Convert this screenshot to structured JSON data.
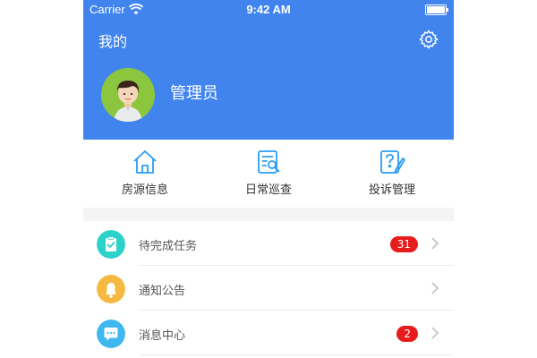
{
  "status_bar": {
    "carrier": "Carrier",
    "time": "9:42 AM"
  },
  "header": {
    "title": "我的",
    "username": "管理员",
    "background": "#4184ee"
  },
  "quick_actions": [
    {
      "label": "房源信息",
      "icon": "house-icon"
    },
    {
      "label": "日常巡查",
      "icon": "inspection-doc-icon"
    },
    {
      "label": "投诉管理",
      "icon": "complaint-icon"
    }
  ],
  "menu": [
    {
      "label": "待完成任务",
      "badge": "31",
      "icon": "clipboard-check-icon",
      "icon_color": "#2ad2c9"
    },
    {
      "label": "通知公告",
      "badge": "",
      "icon": "bell-icon",
      "icon_color": "#f5b840"
    },
    {
      "label": "消息中心",
      "badge": "2",
      "icon": "chat-bubble-icon",
      "icon_color": "#3fb8f0"
    }
  ],
  "colors": {
    "accent": "#4184ee",
    "icon_blue": "#2a9df4",
    "badge_red": "#e71d1d"
  }
}
